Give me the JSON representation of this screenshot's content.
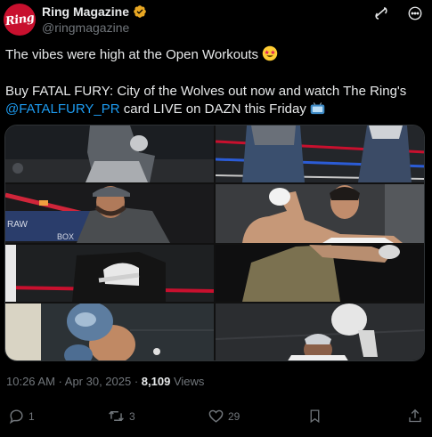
{
  "author": {
    "display_name": "Ring Magazine",
    "handle": "@ringmagazine",
    "avatar_text": "Ring",
    "verified_color": "#e8a723"
  },
  "post": {
    "line1": "The vibes were high at the Open Workouts",
    "line2": "Buy FATAL FURY: City of the Wolves out now and watch The Ring's",
    "mention": "@FATALFURY_PR",
    "line3_rest": " card LIVE on DAZN this Friday"
  },
  "media": {
    "photos": [
      "boxer shadowboxing top-left",
      "boxers in ring top-right",
      "tattooed boxer in cap",
      "boxer flexing arm",
      "boxer in jacket with gloves",
      "boxer throwing punch",
      "boxer with blue gloves",
      "boxer in white gloves"
    ]
  },
  "meta": {
    "time": "10:26 AM",
    "separator": " · ",
    "date": "Apr 30, 2025",
    "separator2": " · ",
    "views_count": "8,109",
    "views_label": " Views"
  },
  "actions": {
    "replies": "1",
    "reposts": "3",
    "likes": "29"
  },
  "icons": {
    "refresh": "grok-icon",
    "more": "more-icon",
    "reply": "reply-icon",
    "repost": "repost-icon",
    "like": "heart-icon",
    "bookmark": "bookmark-icon",
    "share": "share-icon"
  },
  "colors": {
    "background": "#000000",
    "text": "#e7e9ea",
    "muted": "#71767b",
    "link": "#1d9bf0",
    "brand": "#c8102e"
  }
}
